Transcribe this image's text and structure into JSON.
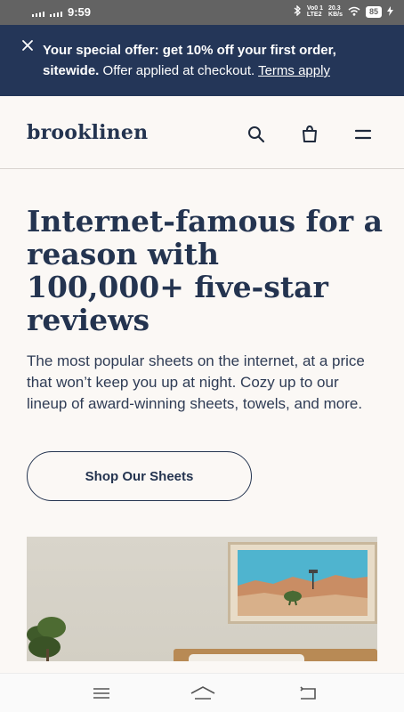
{
  "status_bar": {
    "time": "9:59",
    "network_top": "Vo0 1",
    "network_bottom": "LTE2",
    "speed_top": "20.3",
    "speed_bottom": "KB/s",
    "battery": "85"
  },
  "promo": {
    "bold_text": "Your special offer: get 10% off your first order, sitewide.",
    "text": " Offer applied at checkout. ",
    "link": "Terms apply"
  },
  "header": {
    "logo": "brooklinen",
    "icons": [
      "search-icon",
      "shopping-bag-icon",
      "menu-icon"
    ]
  },
  "hero": {
    "headline": "Internet-famous for a reason with 100,000+ five-star reviews",
    "subtext": "The most popular sheets on the internet, at a price that won’t keep you up at night. Cozy up to our lineup of award-winning sheets, towels, and more.",
    "cta": "Shop Our Sheets"
  },
  "nav_bar": {
    "icons": [
      "recent-apps-icon",
      "home-icon",
      "back-icon"
    ]
  },
  "colors": {
    "navy": "#243658",
    "text": "#243450",
    "background": "#fbf8f5",
    "status_bar": "#636363"
  }
}
